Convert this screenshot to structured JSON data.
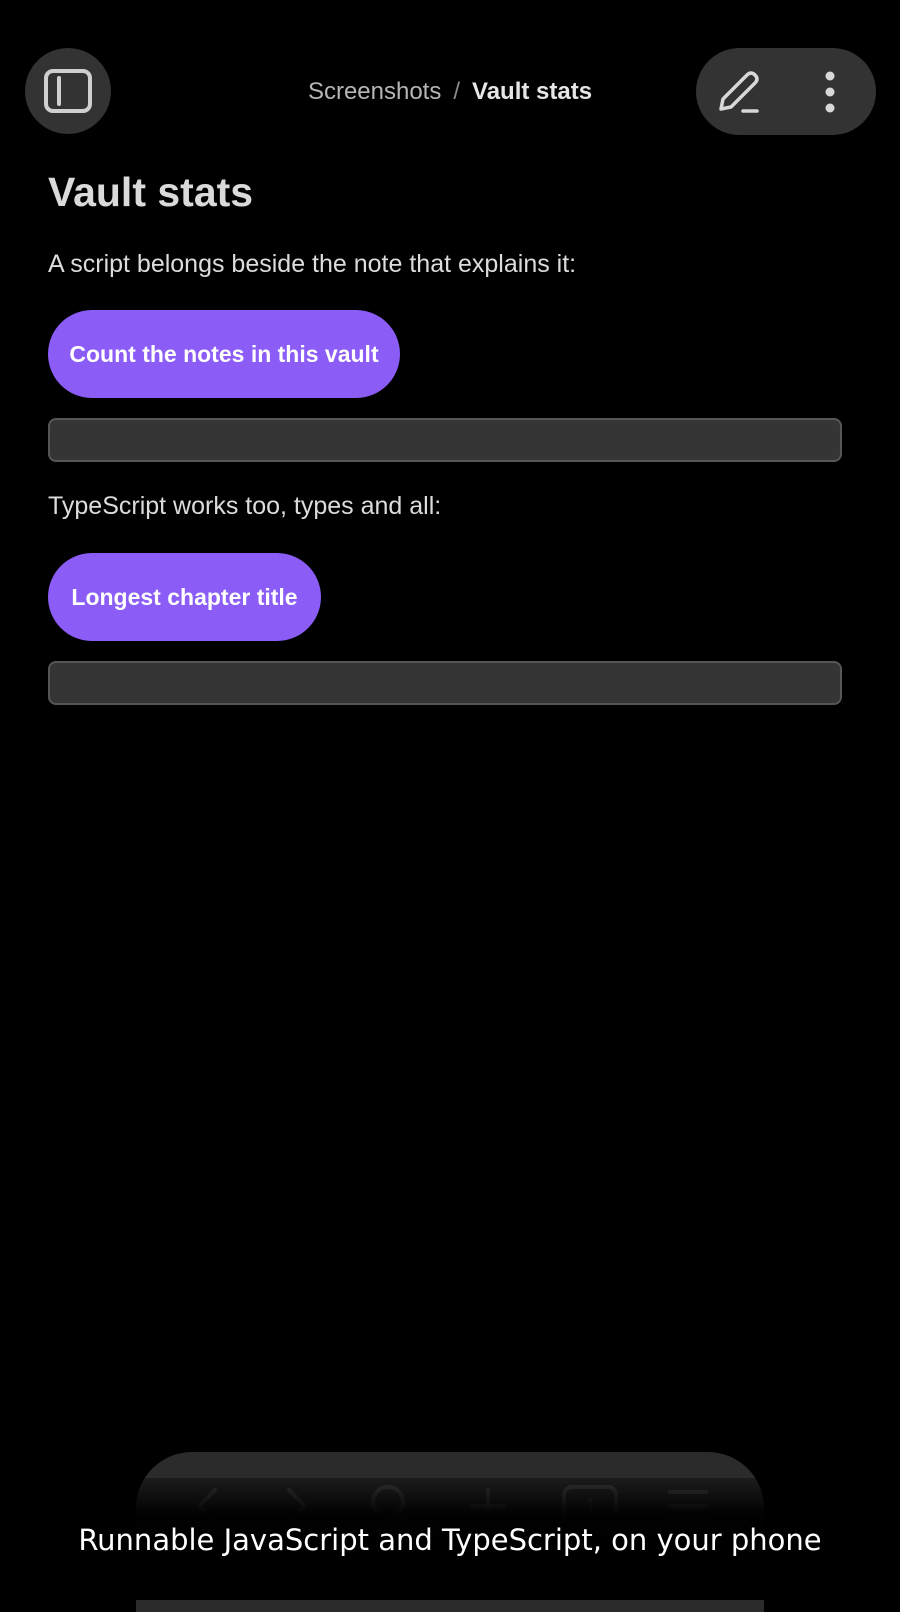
{
  "header": {
    "breadcrumb": {
      "parent": "Screenshots",
      "separator": "/",
      "current": "Vault stats"
    },
    "icons": {
      "sidebar_toggle": "sidebar-panel-icon",
      "edit": "pencil-icon",
      "more": "vertical-ellipsis-icon"
    }
  },
  "note": {
    "title": "Vault stats",
    "blocks": [
      {
        "text": "A script belongs beside the note that explains it:",
        "button_label": "Count the notes in this vault",
        "output": ""
      },
      {
        "text": "TypeScript works too, types and all:",
        "button_label": "Longest chapter title",
        "output": ""
      }
    ]
  },
  "bottom_toolbar": {
    "items": [
      "back-icon",
      "forward-icon",
      "search-icon",
      "plus-icon",
      "tabs-icon",
      "menu-icon"
    ],
    "tab_count": "1"
  },
  "caption": "Runnable JavaScript and TypeScript, on your phone",
  "colors": {
    "background": "#000000",
    "accent": "#8b5cf6",
    "surface": "#333333",
    "output_box": "#353535",
    "text": "#dcdcdc"
  }
}
